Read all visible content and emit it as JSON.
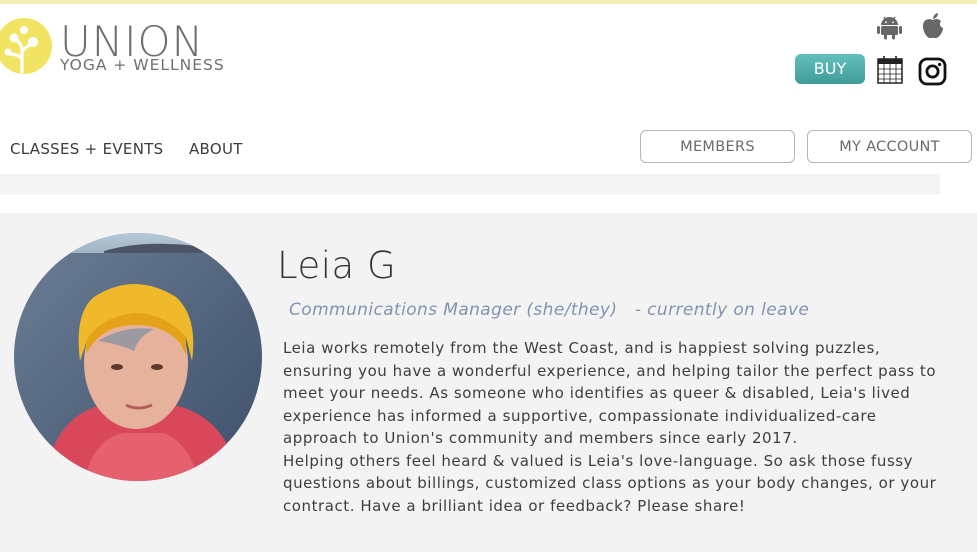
{
  "brand": {
    "name": "UNION",
    "tagline": "YOGA + WELLNESS",
    "logo_icon": "tree-icon",
    "accent_color": "#f2e463"
  },
  "header": {
    "icons": [
      "android-icon",
      "apple-icon",
      "calendar-icon",
      "instagram-icon"
    ],
    "buy_label": "BUY",
    "buy_color": "#4fb0ad"
  },
  "nav": {
    "items": [
      {
        "label": "CLASSES + EVENTS"
      },
      {
        "label": "ABOUT"
      }
    ],
    "members_label": "MEMBERS",
    "account_label": "MY ACCOUNT"
  },
  "profile": {
    "name": "Leia G",
    "role": "Communications Manager (she/they)",
    "status": "- currently on leave",
    "bio": [
      "Leia works remotely from the West Coast, and is happiest solving puzzles, ensuring you have a wonderful experience, and helping tailor the perfect pass to meet your needs.  As someone who identifies as queer & disabled, Leia's lived experience has informed a supportive, compassionate individualized-care approach to Union's community and members since early 2017.",
      "Helping others feel heard & valued is Leia's love-language.  So ask those fussy questions about billings, customized class options as your body changes, or your contract.  Have a brilliant idea or feedback?  Please share!"
    ]
  }
}
